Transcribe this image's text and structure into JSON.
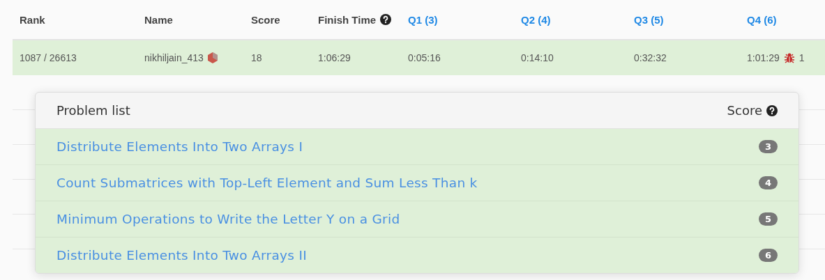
{
  "table": {
    "columns": [
      {
        "label": "Rank",
        "kind": "plain"
      },
      {
        "label": "Name",
        "kind": "plain"
      },
      {
        "label": "Score",
        "kind": "plain"
      },
      {
        "label": "Finish Time",
        "kind": "help"
      },
      {
        "label": "Q1 (3)",
        "kind": "link"
      },
      {
        "label": "Q2 (4)",
        "kind": "link"
      },
      {
        "label": "Q3 (5)",
        "kind": "link"
      },
      {
        "label": "Q4 (6)",
        "kind": "link"
      }
    ],
    "rows": [
      {
        "cells": [
          {
            "text": "1087 / 26613",
            "kind": "plain"
          },
          {
            "text": "nikhiljain_413",
            "kind": "badge"
          },
          {
            "text": "18",
            "kind": "plain"
          },
          {
            "text": "1:06:29",
            "kind": "plain"
          },
          {
            "text": "0:05:16",
            "kind": "plain"
          },
          {
            "text": "0:14:10",
            "kind": "plain"
          },
          {
            "text": "0:32:32",
            "kind": "plain"
          },
          {
            "text": "1:01:29",
            "kind": "bug",
            "penalty": "1"
          }
        ]
      }
    ]
  },
  "problem_list": {
    "title": "Problem list",
    "score_label": "Score",
    "problems": [
      {
        "title": "Distribute Elements Into Two Arrays I",
        "score": "3"
      },
      {
        "title": "Count Submatrices with Top-Left Element and Sum Less Than k",
        "score": "4"
      },
      {
        "title": "Minimum Operations to Write the Letter Y on a Grid",
        "score": "5"
      },
      {
        "title": "Distribute Elements Into Two Arrays II",
        "score": "6"
      }
    ]
  }
}
